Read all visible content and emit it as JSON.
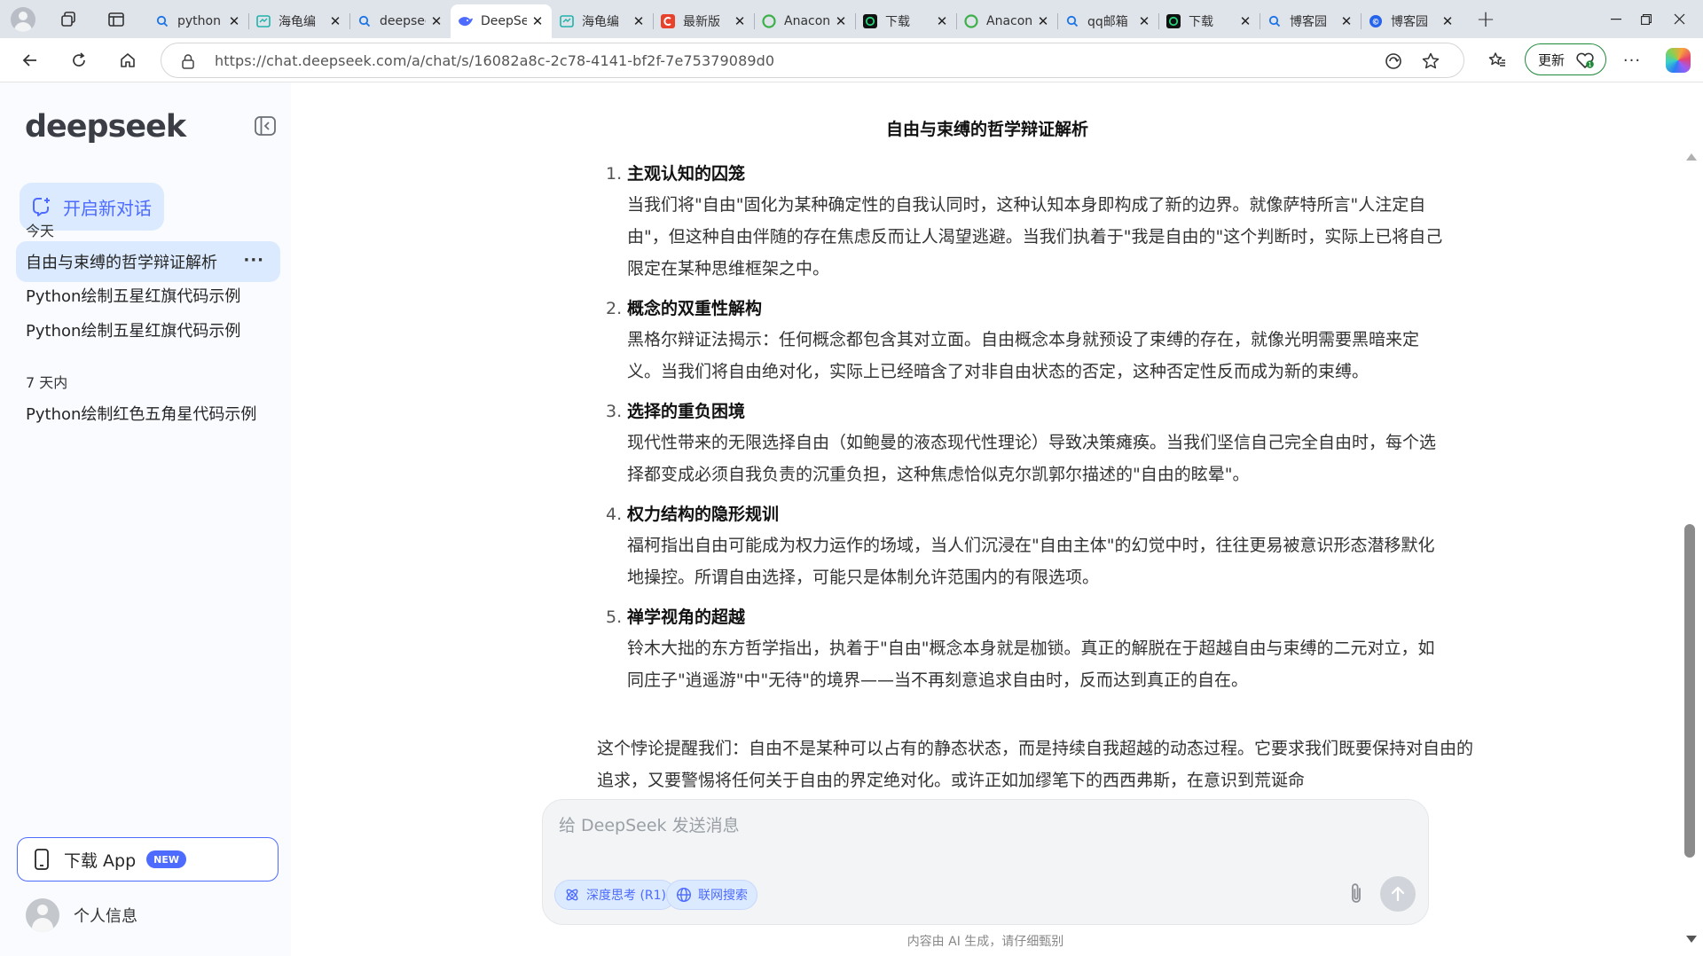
{
  "browser": {
    "tabs": [
      {
        "title": "python",
        "icon": "search-icon",
        "color": "#1a73e8"
      },
      {
        "title": "海龟编",
        "icon": "app-icon",
        "color": "#20b2aa"
      },
      {
        "title": "deepseek",
        "icon": "search-icon",
        "color": "#1a73e8"
      },
      {
        "title": "DeepSeek",
        "icon": "deepseek-whale-icon",
        "color": "#4d6bfe",
        "active": true
      },
      {
        "title": "海龟编",
        "icon": "app-icon",
        "color": "#20b2aa"
      },
      {
        "title": "最新版",
        "icon": "c-logo-icon",
        "color": "#e8412c"
      },
      {
        "title": "Anaconda",
        "icon": "anaconda-icon",
        "color": "#3eb049"
      },
      {
        "title": "下载",
        "icon": "terminal-icon",
        "color": "#111111"
      },
      {
        "title": "Anaconda",
        "icon": "anaconda-icon",
        "color": "#3eb049"
      },
      {
        "title": "qq邮箱",
        "icon": "search-icon",
        "color": "#1a73e8"
      },
      {
        "title": "下载",
        "icon": "terminal-icon",
        "color": "#111111"
      },
      {
        "title": "博客园",
        "icon": "search-icon",
        "color": "#1a73e8"
      },
      {
        "title": "博客园",
        "icon": "blog-icon",
        "color": "#2563eb"
      }
    ],
    "url": "https://chat.deepseek.com/a/chat/s/16082a8c-2c78-4141-bf2f-7e75379089d0",
    "update_label": "更新"
  },
  "sidebar": {
    "logo": "deepseek",
    "new_chat": "开启新对话",
    "groups": [
      {
        "label": "今天",
        "items": [
          {
            "title": "自由与束缚的哲学辩证解析",
            "active": true,
            "more": "···"
          },
          {
            "title": "Python绘制五星红旗代码示例"
          },
          {
            "title": "Python绘制五星红旗代码示例"
          }
        ]
      },
      {
        "label": "7 天内",
        "items": [
          {
            "title": "Python绘制红色五角星代码示例"
          }
        ]
      }
    ],
    "download_app": "下载 App",
    "new_badge": "NEW",
    "profile": "个人信息"
  },
  "chat": {
    "title": "自由与束缚的哲学辩证解析",
    "items": [
      {
        "num": "1.",
        "head": "主观认知的囚笼",
        "body": "当我们将\"自由\"固化为某种确定性的自我认同时，这种认知本身即构成了新的边界。就像萨特所言\"人注定自由\"，但这种自由伴随的存在焦虑反而让人渴望逃避。当我们执着于\"我是自由的\"这个判断时，实际上已将自己限定在某种思维框架之中。"
      },
      {
        "num": "2.",
        "head": "概念的双重性解构",
        "body": "黑格尔辩证法揭示：任何概念都包含其对立面。自由概念本身就预设了束缚的存在，就像光明需要黑暗来定义。当我们将自由绝对化，实际上已经暗含了对非自由状态的否定，这种否定性反而成为新的束缚。"
      },
      {
        "num": "3.",
        "head": "选择的重负困境",
        "body": "现代性带来的无限选择自由（如鲍曼的液态现代性理论）导致决策瘫痪。当我们坚信自己完全自由时，每个选择都变成必须自我负责的沉重负担，这种焦虑恰似克尔凯郭尔描述的\"自由的眩晕\"。"
      },
      {
        "num": "4.",
        "head": "权力结构的隐形规训",
        "body": "福柯指出自由可能成为权力运作的场域，当人们沉浸在\"自由主体\"的幻觉中时，往往更易被意识形态潜移默化地操控。所谓自由选择，可能只是体制允许范围内的有限选项。"
      },
      {
        "num": "5.",
        "head": "禅学视角的超越",
        "body": "铃木大拙的东方哲学指出，执着于\"自由\"概念本身就是枷锁。真正的解脱在于超越自由与束缚的二元对立，如同庄子\"逍遥游\"中\"无待\"的境界——当不再刻意追求自由时，反而达到真正的自在。"
      }
    ],
    "conclusion": "这个悖论提醒我们：自由不是某种可以占有的静态状态，而是持续自我超越的动态过程。它要求我们既要保持对自由的追求，又要警惕将任何关于自由的界定绝对化。或许正如加缪笔下的西西弗斯，在意识到荒诞命",
    "input_placeholder": "给 DeepSeek 发送消息",
    "deep_think": "深度思考 (R1)",
    "web_search": "联网搜索",
    "disclaimer": "内容由 AI 生成，请仔细甄别"
  }
}
